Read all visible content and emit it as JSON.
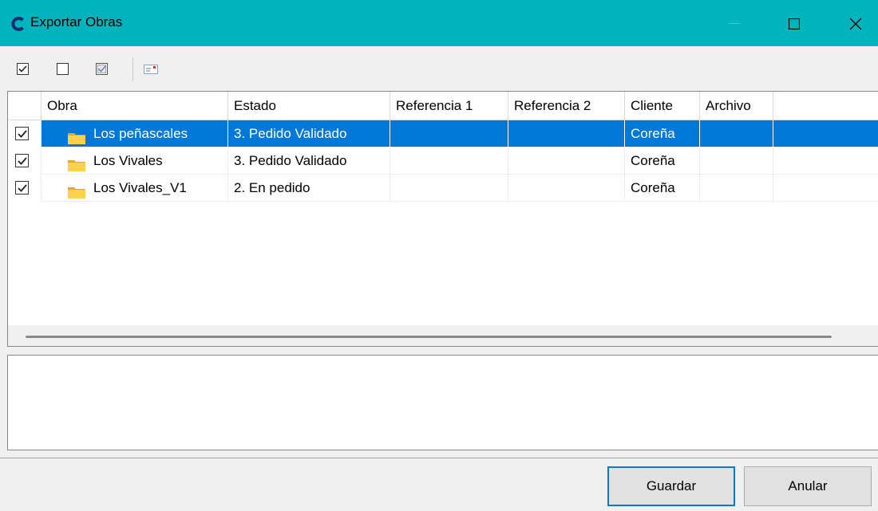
{
  "window": {
    "title": "Exportar Obras",
    "accent": "#00b4be",
    "controls": {
      "minimize": "minimize-icon",
      "maximize": "maximize-icon",
      "close": "close-icon"
    }
  },
  "toolbar": {
    "icons": [
      "check-all-icon",
      "uncheck-all-icon",
      "invert-check-icon",
      "message-icon"
    ]
  },
  "grid": {
    "columns": [
      "Obra",
      "Estado",
      "Referencia 1",
      "Referencia 2",
      "Cliente",
      "Archivo"
    ],
    "rows": [
      {
        "checked": true,
        "obra": "Los peñascales",
        "estado": "3. Pedido Validado",
        "ref1": "",
        "ref2": "",
        "cliente": "Coreña",
        "archivo": "",
        "selected": true
      },
      {
        "checked": true,
        "obra": "Los Vivales",
        "estado": "3. Pedido Validado",
        "ref1": "",
        "ref2": "",
        "cliente": "Coreña",
        "archivo": "",
        "selected": false
      },
      {
        "checked": true,
        "obra": "Los Vivales_V1",
        "estado": "2. En pedido",
        "ref1": "",
        "ref2": "",
        "cliente": "Coreña",
        "archivo": "",
        "selected": false
      }
    ],
    "selection_color": "#0078d7"
  },
  "memo": {
    "value": ""
  },
  "buttons": {
    "save": "Guardar",
    "cancel": "Anular"
  }
}
